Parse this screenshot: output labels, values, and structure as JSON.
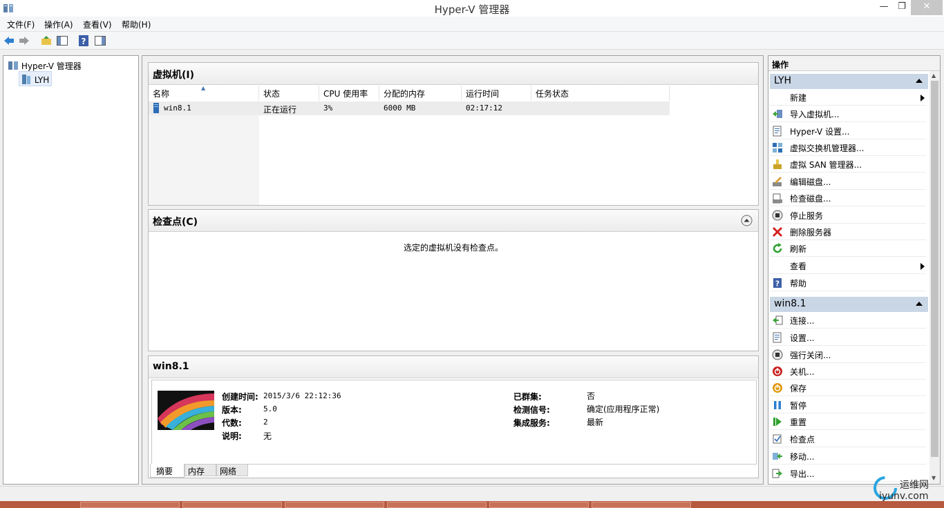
{
  "window": {
    "title": "Hyper-V 管理器"
  },
  "menu": [
    "文件(F)",
    "操作(A)",
    "查看(V)",
    "帮助(H)"
  ],
  "tree": {
    "root": "Hyper-V 管理器",
    "server": "LYH"
  },
  "vm_panel": {
    "title": "虚拟机(I)",
    "columns": [
      "名称",
      "状态",
      "CPU 使用率",
      "分配的内存",
      "运行时间",
      "任务状态"
    ],
    "rows": [
      {
        "name": "win8.1",
        "state": "正在运行",
        "cpu": "3%",
        "memory": "6000 MB",
        "uptime": "02:17:12",
        "task": ""
      }
    ]
  },
  "checkpoint_panel": {
    "title": "检查点(C)",
    "empty_message": "选定的虚拟机没有检查点。"
  },
  "details_panel": {
    "title": "win8.1",
    "left": [
      {
        "label": "创建时间:",
        "value": "2015/3/6 22:12:36"
      },
      {
        "label": "版本:",
        "value": "5.0"
      },
      {
        "label": "代数:",
        "value": "2"
      },
      {
        "label": "说明:",
        "value": "无"
      }
    ],
    "right": [
      {
        "label": "已群集:",
        "value": "否"
      },
      {
        "label": "检测信号:",
        "value": "确定(应用程序正常)"
      },
      {
        "label": "集成服务:",
        "value": "最新"
      }
    ],
    "tabs": [
      "摘要",
      "内存",
      "网络"
    ],
    "active_tab": "摘要"
  },
  "actions_pane": {
    "header": "操作",
    "groups": [
      {
        "title": "LYH",
        "items": [
          {
            "label": "新建",
            "icon": "none",
            "submenu": true
          },
          {
            "label": "导入虚拟机...",
            "icon": "import-icon"
          },
          {
            "label": "Hyper-V 设置...",
            "icon": "settings-icon"
          },
          {
            "label": "虚拟交换机管理器...",
            "icon": "switch-icon"
          },
          {
            "label": "虚拟 SAN 管理器...",
            "icon": "san-icon"
          },
          {
            "label": "编辑磁盘...",
            "icon": "edit-disk-icon"
          },
          {
            "label": "检查磁盘...",
            "icon": "inspect-disk-icon"
          },
          {
            "label": "停止服务",
            "icon": "stop-icon"
          },
          {
            "label": "删除服务器",
            "icon": "delete-icon"
          },
          {
            "label": "刷新",
            "icon": "refresh-icon"
          },
          {
            "label": "查看",
            "icon": "none",
            "submenu": true
          },
          {
            "label": "帮助",
            "icon": "help-icon"
          }
        ]
      },
      {
        "title": "win8.1",
        "items": [
          {
            "label": "连接...",
            "icon": "connect-icon"
          },
          {
            "label": "设置...",
            "icon": "vm-settings-icon"
          },
          {
            "label": "强行关闭...",
            "icon": "turn-off-icon"
          },
          {
            "label": "关机...",
            "icon": "shutdown-icon"
          },
          {
            "label": "保存",
            "icon": "save-icon"
          },
          {
            "label": "暂停",
            "icon": "pause-icon"
          },
          {
            "label": "重置",
            "icon": "reset-icon"
          },
          {
            "label": "检查点",
            "icon": "checkpoint-icon"
          },
          {
            "label": "移动...",
            "icon": "move-icon"
          },
          {
            "label": "导出...",
            "icon": "export-icon"
          }
        ]
      }
    ]
  },
  "watermark": {
    "brand": "运维网",
    "domain": "iyunv.com"
  },
  "colors": {
    "group_header": "#c9d6e6",
    "taskbar": "#b7593e",
    "close_button": "#c7c7c7"
  }
}
